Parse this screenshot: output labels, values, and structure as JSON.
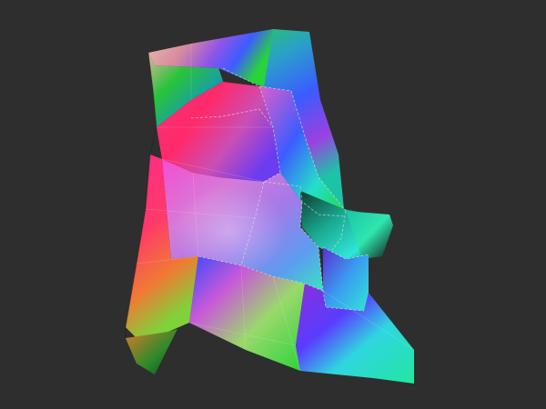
{
  "viewport": {
    "background": "#2e2e2e"
  },
  "mesh": {
    "shading": "vertex-normal-color",
    "wireframe_overlay": "dashed-edges",
    "palette": {
      "magenta": "#ff2a8a",
      "pink": "#f06ab8",
      "violet": "#9b5cf0",
      "blue": "#3d5cff",
      "cyan": "#2fe6d8",
      "teal": "#1ec2a6",
      "green": "#28d43a",
      "dark_green": "#1b6d1f",
      "orange": "#f07a34",
      "salmon": "#e79479",
      "peach": "#e0b6a0",
      "purple": "#8a2fd6",
      "edge": "#d8d8d8"
    }
  }
}
